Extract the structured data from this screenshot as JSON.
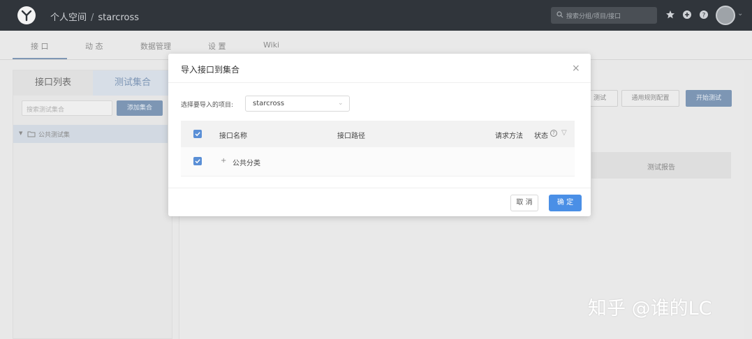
{
  "header": {
    "breadcrumb_space": "个人空间",
    "breadcrumb_sep": "/",
    "breadcrumb_project": "starcross",
    "search_placeholder": "搜索分组/项目/接口"
  },
  "nav": {
    "tabs": [
      {
        "label": "接 口"
      },
      {
        "label": "动 态"
      },
      {
        "label": "数据管理"
      },
      {
        "label": "设 置"
      },
      {
        "label": "Wiki"
      }
    ]
  },
  "sidebar": {
    "tab_list": "接口列表",
    "tab_collection": "测试集合",
    "search_placeholder": "搜索测试集合",
    "add_button": "添加集合",
    "tree_item": "公共测试集"
  },
  "content": {
    "btn_common_rules": "通用规则配置",
    "btn_start_test": "开始测试",
    "btn_partial": "测试",
    "col_report": "测试报告"
  },
  "modal": {
    "title": "导入接口到集合",
    "close": "×",
    "project_label": "选择要导入的项目:",
    "project_value": "starcross",
    "columns": {
      "name": "接口名称",
      "path": "接口路径",
      "method": "请求方法",
      "status": "状态"
    },
    "rows": [
      {
        "expander": "+",
        "label": "公共分类"
      }
    ],
    "cancel": "取 消",
    "ok": "确 定"
  },
  "watermark": "知乎 @谁的LC",
  "colors": {
    "topbar": "#30353b",
    "primary": "#4a8fe6",
    "checkbox": "#5a8fd6"
  }
}
